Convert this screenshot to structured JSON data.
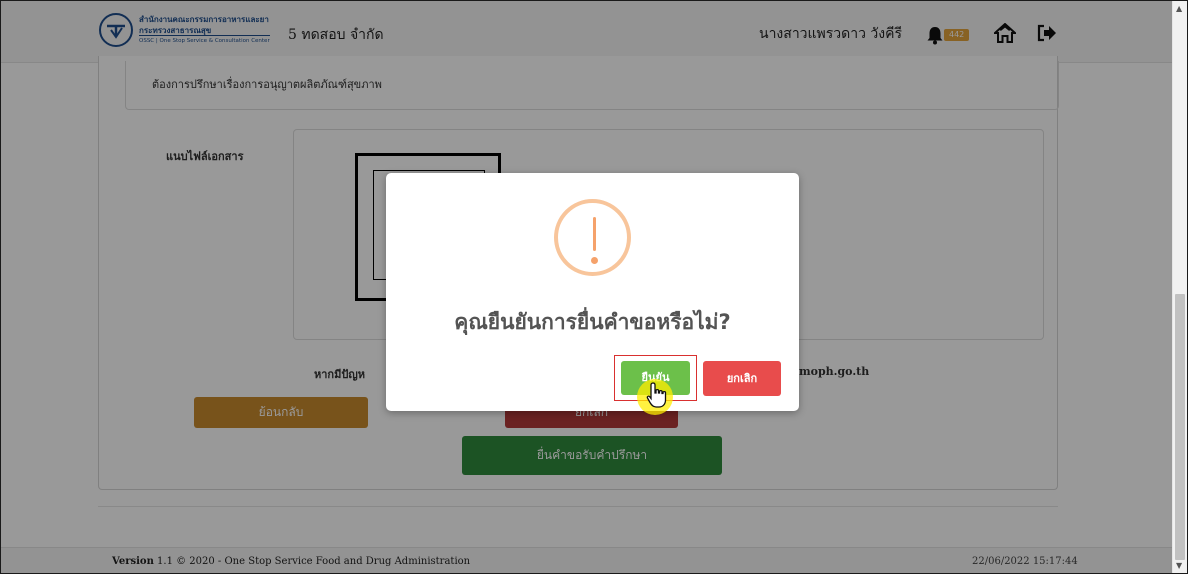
{
  "header": {
    "logo": {
      "line1": "สำนักงานคณะกรรมการอาหารและยา",
      "line2": "กระทรวงสาธารณสุข",
      "line3": "OSSC | One Stop Service & Consultation Center"
    },
    "company": "5 ทดสอบ จำกัด",
    "user_name": "นางสาวแพรวดาว วังคีรี",
    "notification_count": "442"
  },
  "form": {
    "description": "ต้องการปรึกษาเรื่องการอนุญาตผลิตภัณฑ์สุขภาพ",
    "attach_label": "แนบไฟล์เอกสาร",
    "help_left": "หากมีปัญห",
    "help_right": "moph.go.th",
    "back_label": "ย้อนกลับ",
    "cancel_label": "ยกเลิก",
    "submit_label": "ยื่นคำขอรับคำปรึกษา"
  },
  "footer": {
    "version_label": "Version",
    "version_text": "1.1 © 2020 - One Stop Service Food and Drug Administration",
    "datetime": "22/06/2022 15:17:44"
  },
  "modal": {
    "title": "คุณยืนยันการยื่นคำขอหรือไม่?",
    "confirm_label": "ยืนยัน",
    "cancel_label": "ยกเลิก",
    "icon": "warning-icon"
  },
  "colors": {
    "confirm": "#6cc04a",
    "cancel": "#e84c4c",
    "warning": "#f8c59b",
    "submit": "#2f8a3d",
    "back": "#c98a2e"
  }
}
